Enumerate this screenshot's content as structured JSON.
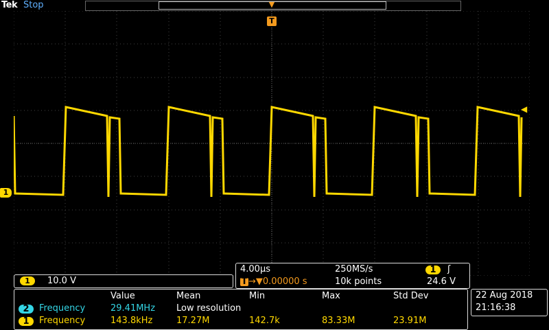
{
  "header": {
    "brand": "Tek",
    "status": "Stop",
    "trigger_position_marker": "T"
  },
  "channel1": {
    "marker": "1",
    "scale": "10.0 V"
  },
  "horizontal": {
    "time_per_div": "4.00µs",
    "sample_rate": "250MS/s",
    "trigger_delay": "0.00000 s",
    "record_length": "10k points",
    "trigger_source": "1",
    "trigger_slope_symbol": "ʃ",
    "trigger_level": "24.6 V"
  },
  "measurements": {
    "headers": [
      "Value",
      "Mean",
      "Min",
      "Max",
      "Std Dev"
    ],
    "rows": [
      {
        "source": "2",
        "name": "Frequency",
        "value": "29.41MHz",
        "mean": "Low resolution",
        "min": "",
        "max": "",
        "std": ""
      },
      {
        "source": "1",
        "name": "Frequency",
        "value": "143.8kHz",
        "mean": "17.27M",
        "min": "142.7k",
        "max": "83.33M",
        "std": "23.91M"
      }
    ]
  },
  "datetime": {
    "date": "22 Aug 2018",
    "time": "21:16:38"
  },
  "colors": {
    "ch1": "#ffd800",
    "ch2": "#34d6e6",
    "trigger": "#f39a1e",
    "status": "#5fb0ff"
  }
}
